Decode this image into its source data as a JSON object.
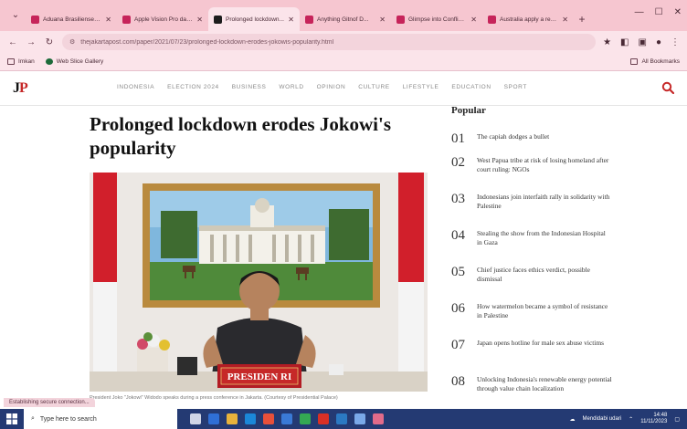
{
  "browser": {
    "tabs": [
      {
        "title": "Aduana Brasiliense ke...",
        "active": false
      },
      {
        "title": "Apple Vision Pro dan...",
        "active": false
      },
      {
        "title": "Prolonged lockdown...",
        "active": true
      },
      {
        "title": "Anything Gitnof D...",
        "active": false
      },
      {
        "title": "Glimpse into Conflict...",
        "active": false
      },
      {
        "title": "Australia apply a rese...",
        "active": false
      }
    ],
    "new_tab": "+",
    "url": "thejakartapost.com/paper/2021/07/23/prolonged-lockdown-erodes-jokowis-popularity.html",
    "bookmarks": [
      {
        "label": "Imkan",
        "icon": "folder-icon"
      },
      {
        "label": "Web Slice Gallery",
        "icon": "globe-icon"
      }
    ],
    "all_bookmarks": "All Bookmarks"
  },
  "site": {
    "logo_j": "J",
    "logo_p": "P",
    "nav": [
      "INDONESIA",
      "ELECTION 2024",
      "BUSINESS",
      "WORLD",
      "OPINION",
      "CULTURE",
      "LIFESTYLE",
      "EDUCATION",
      "SPORT"
    ]
  },
  "article": {
    "headline": "Prolonged lockdown erodes Jokowi's popularity",
    "podium_text": "PRESIDEN RI",
    "caption": "President Joko \"Jokowi\" Widodo speaks during a press conference in Jakarta. (Courtesy of Presidential Palace)"
  },
  "popular": {
    "heading": "Popular",
    "items": [
      {
        "num": "01",
        "text": "The capiah dodges a bullet"
      },
      {
        "num": "02",
        "text": "West Papua tribe at risk of losing homeland after court ruling: NGOs"
      },
      {
        "num": "03",
        "text": "Indonesians join interfaith rally in solidarity with Palestine"
      },
      {
        "num": "04",
        "text": "Stealing the show from the Indonesian Hospital in Gaza"
      },
      {
        "num": "05",
        "text": "Chief justice faces ethics verdict, possible dismissal"
      },
      {
        "num": "06",
        "text": "How watermelon became a symbol of resistance in Palestine"
      },
      {
        "num": "07",
        "text": "Japan opens hotline for male sex abuse victims"
      },
      {
        "num": "08",
        "text": "Unlocking Indonesia's renewable energy potential through value chain localization"
      }
    ]
  },
  "status_bar": "Establishing secure connection...",
  "taskbar": {
    "search_placeholder": "Type here to search",
    "weather": "Mendidabi udari",
    "time": "14:48",
    "date": "11/11/2023"
  },
  "colors": {
    "tabbar": "#f6c6d0",
    "toolbar": "#fbe4ea",
    "taskbar": "#243a73",
    "accent": "#c62828"
  }
}
